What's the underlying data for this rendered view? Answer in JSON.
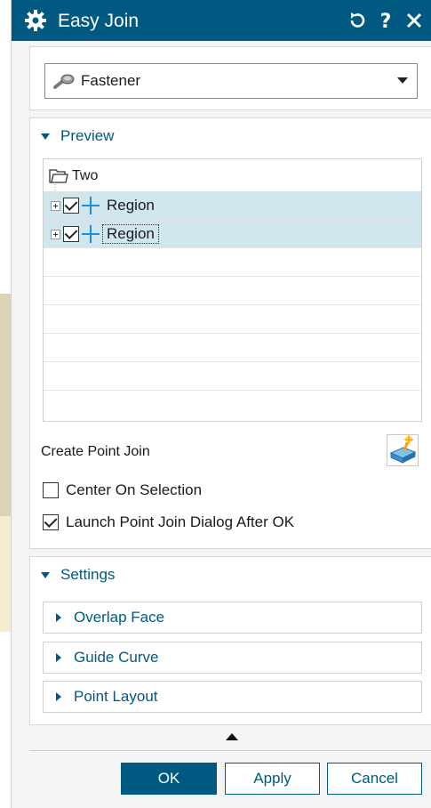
{
  "dialog": {
    "title": "Easy Join"
  },
  "type_select": {
    "value": "Fastener"
  },
  "preview": {
    "heading": "Preview",
    "tree_root": "Two",
    "items": [
      {
        "label": "Region",
        "checked": true
      },
      {
        "label": "Region",
        "checked": true
      }
    ],
    "create_point_join_label": "Create Point Join",
    "options": [
      {
        "label": "Center On Selection",
        "checked": false
      },
      {
        "label": "Launch Point Join Dialog After OK",
        "checked": true
      }
    ]
  },
  "settings": {
    "heading": "Settings",
    "groups": [
      "Overlap Face",
      "Guide Curve",
      "Point Layout"
    ]
  },
  "footer": {
    "ok": "OK",
    "apply": "Apply",
    "cancel": "Cancel"
  },
  "colors": {
    "accent": "#005980",
    "selection": "#cfe6ee"
  }
}
